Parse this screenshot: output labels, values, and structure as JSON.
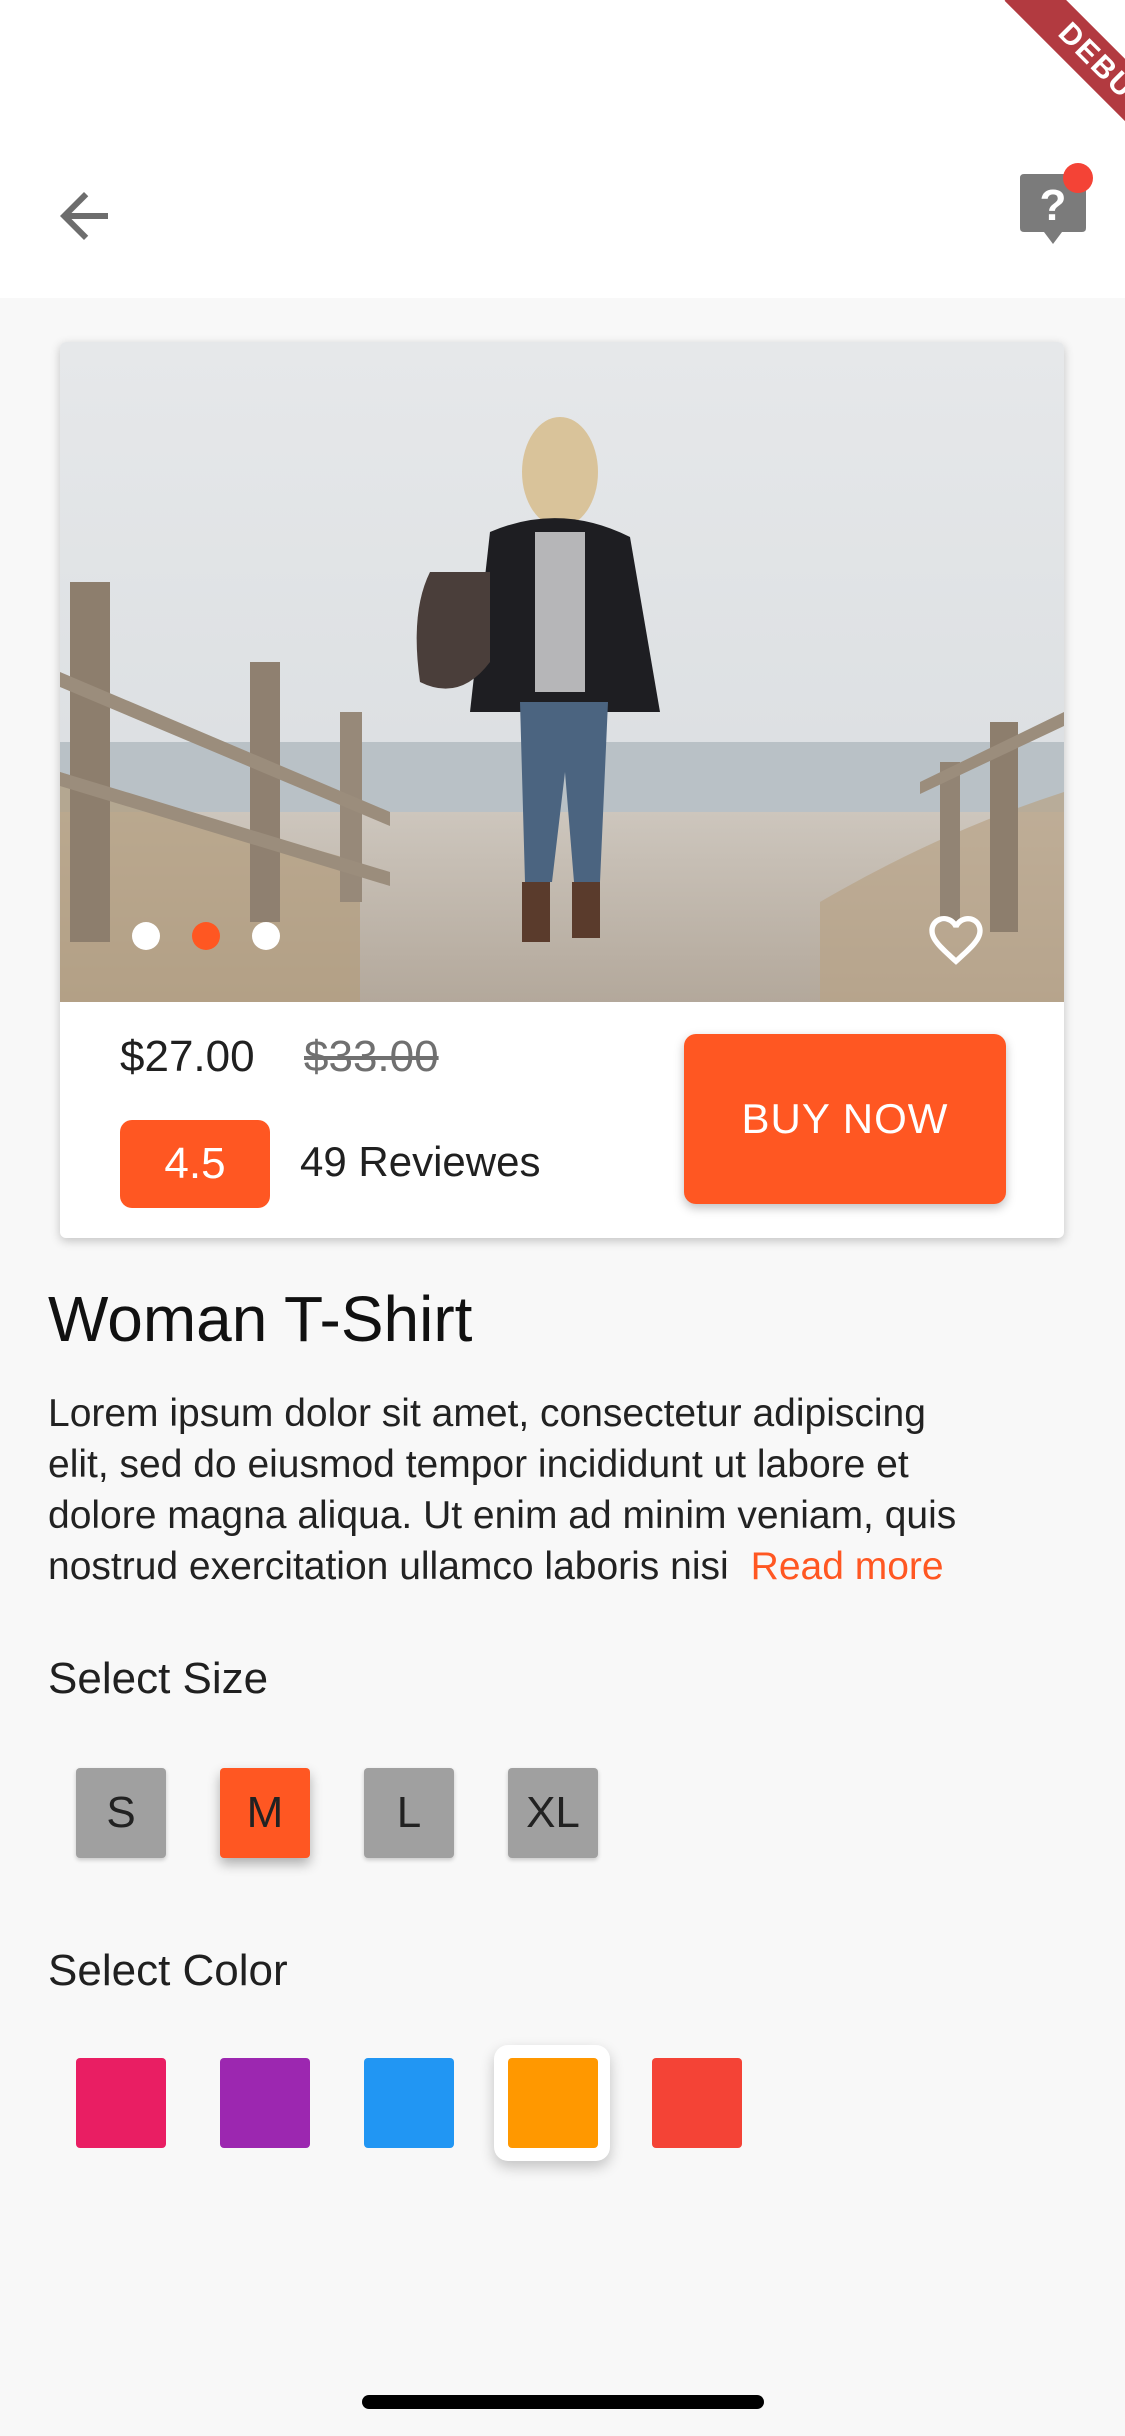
{
  "appbar": {
    "back_icon": "arrow-back-icon",
    "help_icon": "help-bubble-icon",
    "badge_color": "#f44336"
  },
  "debug_banner": {
    "label": "DEBUG"
  },
  "product_card": {
    "image_desc_icon": "product-photo",
    "carousel": {
      "page_count": 3,
      "active_index": 1
    },
    "favorite_icon": "heart-outline-icon",
    "price": "$27.00",
    "old_price": "$33.00",
    "rating": "4.5",
    "reviews": "49 Reviewes",
    "buy_label": "BUY NOW"
  },
  "product": {
    "title": "Woman T-Shirt",
    "description_lines": [
      "Lorem ipsum dolor sit amet, consectetur adipiscing",
      "elit, sed do eiusmod tempor incididunt ut labore et",
      "dolore magna aliqua. Ut enim ad minim veniam, quis",
      "nostrud exercitation ullamco laboris nisi"
    ],
    "read_more": "Read more"
  },
  "size_section": {
    "label": "Select Size",
    "options": [
      "S",
      "M",
      "L",
      "XL"
    ],
    "selected": "M"
  },
  "color_section": {
    "label": "Select Color",
    "options": [
      "#e91e63",
      "#9c27b0",
      "#2196f3",
      "#ff9800",
      "#f44336"
    ],
    "selected_index": 3
  },
  "theme": {
    "accent": "#ff5722"
  }
}
